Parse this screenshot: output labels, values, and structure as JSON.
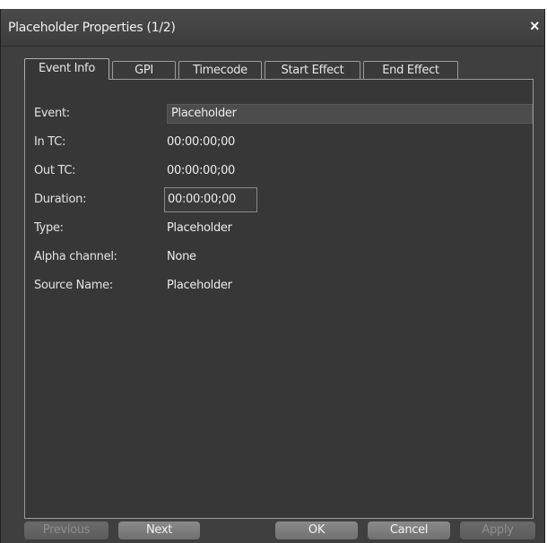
{
  "window": {
    "title": "Placeholder Properties (1/2)",
    "close_label": "×"
  },
  "tabs": [
    {
      "label": "Event Info",
      "active": true
    },
    {
      "label": "GPI",
      "active": false
    },
    {
      "label": "Timecode",
      "active": false
    },
    {
      "label": "Start Effect",
      "active": false
    },
    {
      "label": "End Effect",
      "active": false
    }
  ],
  "fields": {
    "event": {
      "label": "Event:",
      "value": "Placeholder"
    },
    "in_tc": {
      "label": "In TC:",
      "value": "00:00:00;00"
    },
    "out_tc": {
      "label": "Out TC:",
      "value": "00:00:00;00"
    },
    "duration": {
      "label": "Duration:",
      "value": "00:00:00;00"
    },
    "type": {
      "label": "Type:",
      "value": "Placeholder"
    },
    "alpha_channel": {
      "label": "Alpha channel:",
      "value": "None"
    },
    "source_name": {
      "label": "Source Name:",
      "value": "Placeholder"
    }
  },
  "buttons": {
    "previous": {
      "label": "Previous",
      "enabled": false
    },
    "next": {
      "label": "Next",
      "enabled": true
    },
    "ok": {
      "label": "OK",
      "enabled": true
    },
    "cancel": {
      "label": "Cancel",
      "enabled": true
    },
    "apply": {
      "label": "Apply",
      "enabled": false
    }
  }
}
